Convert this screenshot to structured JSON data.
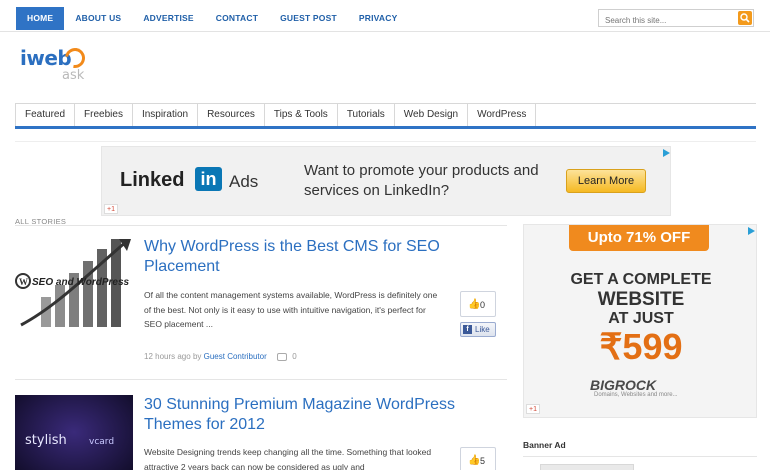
{
  "topnav": {
    "items": [
      "HOME",
      "ABOUT US",
      "ADVERTISE",
      "CONTACT",
      "GUEST POST",
      "PRIVACY"
    ],
    "active": "HOME"
  },
  "search": {
    "placeholder": "Search this site..."
  },
  "logo": {
    "part1": "iweb",
    "part2": "ask"
  },
  "catnav": [
    "Featured",
    "Freebies",
    "Inspiration",
    "Resources",
    "Tips & Tools",
    "Tutorials",
    "Web Design",
    "WordPress"
  ],
  "banner": {
    "brand": "Linked",
    "brand_in": "in",
    "brand_suffix": "Ads",
    "message": "Want to promote your products and services on LinkedIn?",
    "cta": "Learn More",
    "gplus": "+1"
  },
  "section_label": "ALL STORIES",
  "posts": [
    {
      "title": "Why WordPress is the Best CMS for SEO Placement",
      "excerpt": "Of all the content management systems available, WordPress is definitely one of the best. Not only is it easy to use with intuitive navigation, it's perfect for SEO placement ...",
      "time": "12 hours ago",
      "by": "by",
      "author": "Guest Contributor",
      "comments": "0",
      "likes": "0",
      "like_label": "Like",
      "thumb_text": "SEO and WordPress"
    },
    {
      "title": "30 Stunning Premium Magazine WordPress Themes for 2012",
      "excerpt": "Website Designing trends keep changing all the time. Something that looked attractive 2 years back can now be considered as ugly and",
      "likes": "5",
      "thumb_text": "stylish",
      "thumb_text2": "vcard"
    }
  ],
  "sidebar_ad": {
    "top": "Upto 71% OFF",
    "line1": "GET A COMPLETE",
    "line2": "WEBSITE",
    "line3": "AT JUST",
    "price": "₹599",
    "brand": "BIGROCK",
    "tagline": "Domains, Websites and more...",
    "gplus": "+1"
  },
  "banner_ad_label": "Banner Ad",
  "colors": {
    "accent": "#2f73c5",
    "link": "#2b6fc0",
    "orange": "#f08a1e"
  }
}
